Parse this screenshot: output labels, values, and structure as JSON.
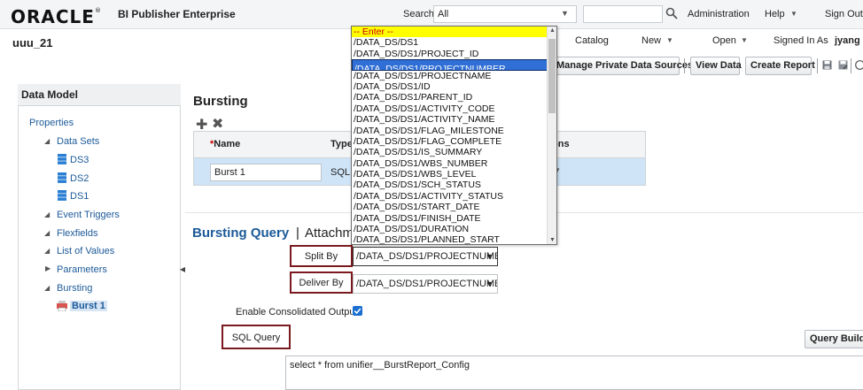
{
  "header": {
    "logo": "ORACLE",
    "logo_mark": "®",
    "product": "BI Publisher Enterprise",
    "search_label": "Search",
    "search_scope": "All",
    "search_value": "",
    "admin": "Administration",
    "help": "Help",
    "signout": "Sign Out"
  },
  "subheader": {
    "report_name": "uuu_21",
    "catalog": "Catalog",
    "new": "New",
    "open": "Open",
    "signed_in_label": "Signed In As",
    "user": "jyang"
  },
  "toolbar": {
    "manage_private": "Manage Private Data Sources",
    "view_data": "View Data",
    "create_report": "Create Report"
  },
  "left": {
    "title": "Data Model",
    "properties": "Properties",
    "data_sets": "Data Sets",
    "ds": [
      "DS3",
      "DS2",
      "DS1"
    ],
    "event_triggers": "Event Triggers",
    "flexfields": "Flexfields",
    "list_of_values": "List of Values",
    "parameters": "Parameters",
    "bursting": "Bursting",
    "burst_item": "Burst 1"
  },
  "bursting": {
    "title": "Bursting",
    "col_name": "Name",
    "col_name_req": "*",
    "col_type": "Type",
    "col_options": "ions",
    "row_name": "Burst 1",
    "row_type": "SQL"
  },
  "query": {
    "tab_query": "Bursting Query",
    "tab_sep": "|",
    "tab_attach": "Attachm",
    "split_by_label": "Split By",
    "split_by_value": "/DATA_DS/DS1/PROJECTNUMBE",
    "deliver_by_label": "Deliver By",
    "deliver_by_value": "/DATA_DS/DS1/PROJECTNUMBE",
    "consolidated_label": "Enable Consolidated Output",
    "consolidated_checked": true,
    "sql_label": "SQL Query",
    "query_builder": "Query Builde",
    "sql_text": "select * from unifier__BurstReport_Config"
  },
  "dropdown": {
    "items": [
      "-- Enter --",
      "/DATA_DS/DS1",
      "/DATA_DS/DS1/PROJECT_ID",
      "/DATA_DS/DS1/PROJECTNUMBER",
      "/DATA_DS/DS1/PROJECTNAME",
      "/DATA_DS/DS1/ID",
      "/DATA_DS/DS1/PARENT_ID",
      "/DATA_DS/DS1/ACTIVITY_CODE",
      "/DATA_DS/DS1/ACTIVITY_NAME",
      "/DATA_DS/DS1/FLAG_MILESTONE",
      "/DATA_DS/DS1/FLAG_COMPLETE",
      "/DATA_DS/DS1/IS_SUMMARY",
      "/DATA_DS/DS1/WBS_NUMBER",
      "/DATA_DS/DS1/WBS_LEVEL",
      "/DATA_DS/DS1/SCH_STATUS",
      "/DATA_DS/DS1/ACTIVITY_STATUS",
      "/DATA_DS/DS1/START_DATE",
      "/DATA_DS/DS1/FINISH_DATE",
      "/DATA_DS/DS1/DURATION",
      "/DATA_DS/DS1/PLANNED_START"
    ],
    "selected": 3
  },
  "colors": {
    "accent": "#1c5a99",
    "highlight_box": "#7a1a1e",
    "row_selected": "#cfe4f7"
  }
}
